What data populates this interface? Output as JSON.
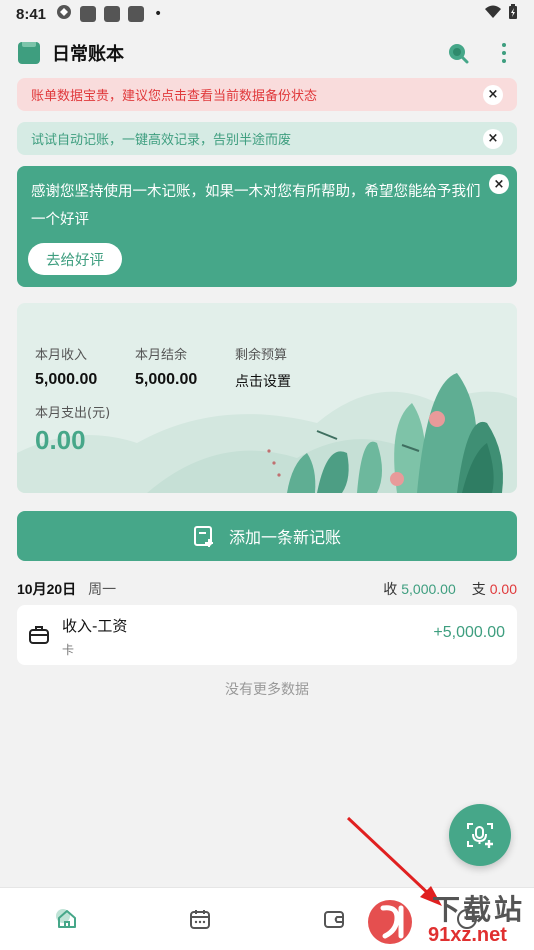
{
  "status_bar": {
    "time": "8:41",
    "dot": "•"
  },
  "app_bar": {
    "title": "日常账本"
  },
  "notices": {
    "backup": "账单数据宝贵，建议您点击查看当前数据备份状态",
    "auto": "试试自动记账，一键高效记录，告别半途而废",
    "close_glyph": "×"
  },
  "thanks_card": {
    "text": "感谢您坚持使用一木记账，如果一木对您有所帮助，希望您能给予我们一个好评",
    "button": "去给好评"
  },
  "summary": {
    "income_label": "本月收入",
    "income_value": "5,000.00",
    "balance_label": "本月结余",
    "balance_value": "5,000.00",
    "budget_label": "剩余预算",
    "budget_value": "点击设置",
    "expense_label": "本月支出(元)",
    "expense_value": "0.00"
  },
  "add_button": {
    "label": "添加一条新记账"
  },
  "day": {
    "date": "10月20日",
    "weekday": "周一",
    "income_label": "收",
    "income_value": "5,000.00",
    "expense_label": "支",
    "expense_value": "0.00"
  },
  "records": [
    {
      "title": "收入-工资",
      "account": "卡",
      "amount": "+5,000.00",
      "icon": "briefcase-icon"
    }
  ],
  "list_footer": "没有更多数据",
  "bottom_nav": [
    {
      "icon": "home-icon",
      "active": true
    },
    {
      "icon": "calendar-icon",
      "active": false
    },
    {
      "icon": "wallet-icon",
      "active": false
    },
    {
      "icon": "chart-icon",
      "active": false
    }
  ],
  "watermark": {
    "brand": "下载站",
    "site": "91xz.net"
  },
  "colors": {
    "accent": "#46a789",
    "income": "#3e9e7f",
    "expense": "#e0393b",
    "annotation": "#e02020"
  }
}
